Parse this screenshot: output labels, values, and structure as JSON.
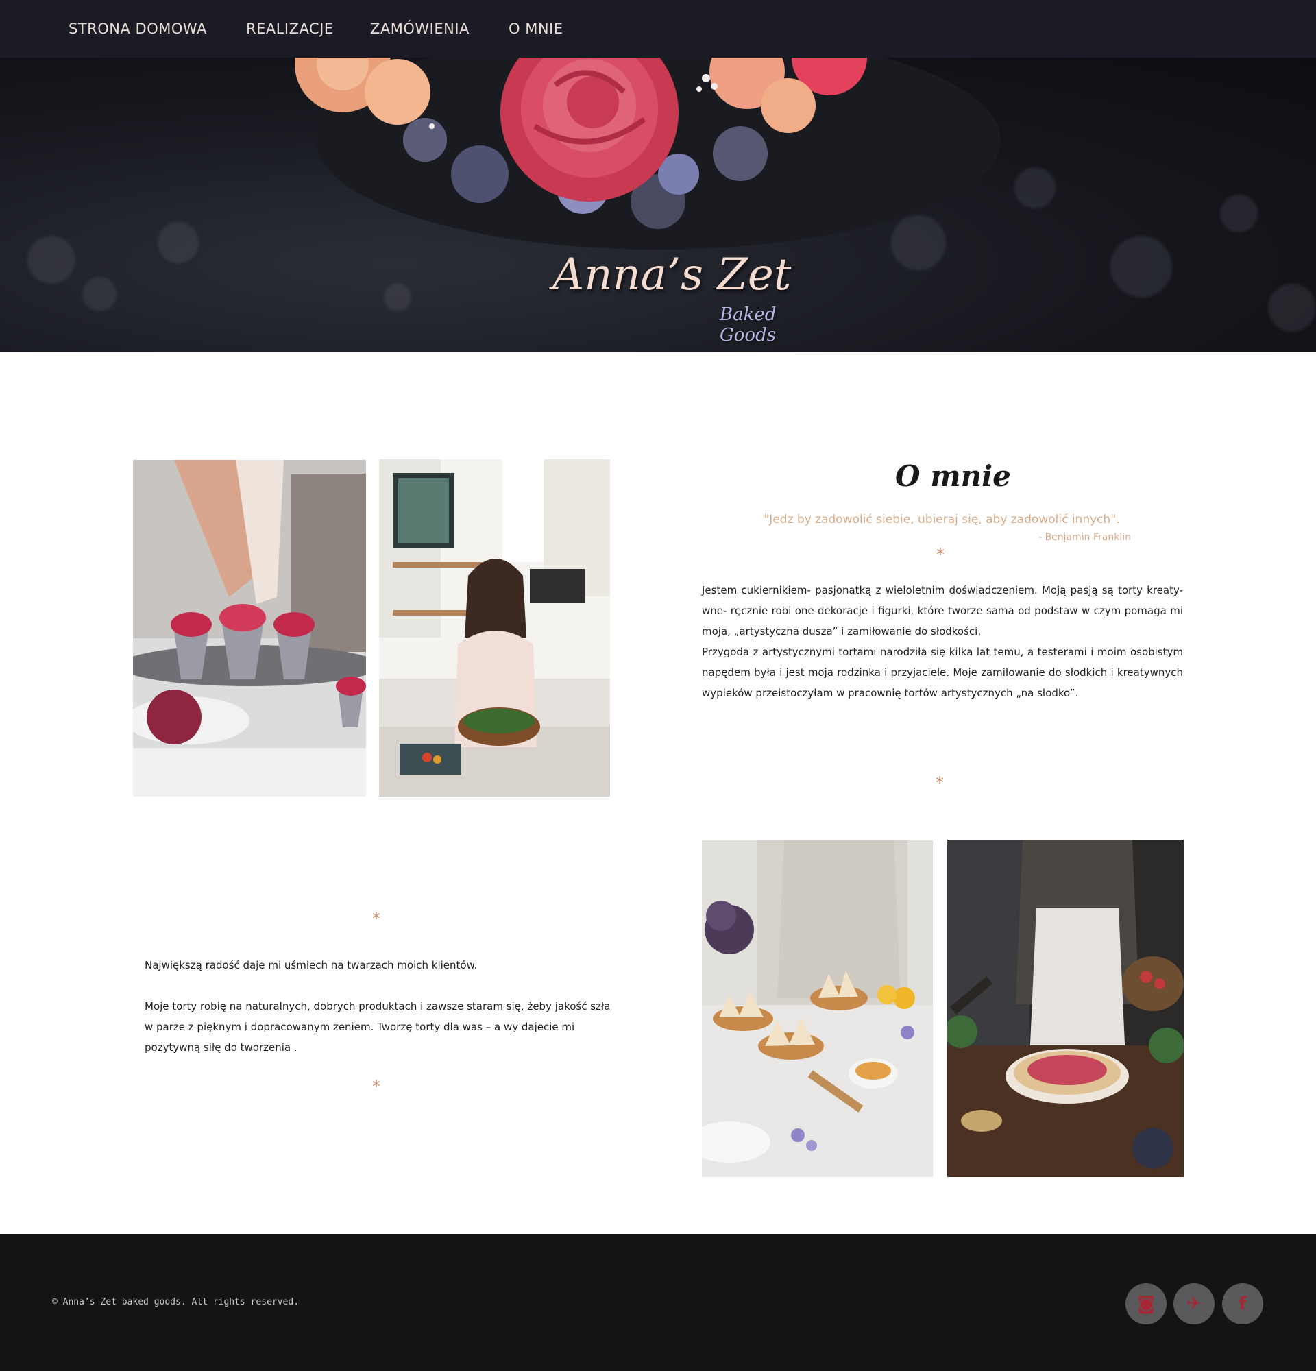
{
  "nav": {
    "items": [
      "STRONA DOMOWA",
      "REALIZACJE",
      "ZAMÓWIENIA",
      "O MNIE"
    ]
  },
  "hero": {
    "logo_main": "Anna’s Zet",
    "logo_sub": "Baked Goods"
  },
  "about": {
    "heading": "O mnie",
    "quote": "\"Jedz by zadowolić siebie, ubieraj się, aby zadowolić innych\".",
    "quote_author": "- Benjamin Franklin",
    "separator": "*",
    "paragraph1": "Jestem cukiernikiem- pasjonatką z wieloletnim doświadczeniem. Moją pasją są torty kreaty-wne- ręcznie robi one dekoracje i figurki, które tworze sama od podstaw w czym pomaga mi moja, „artystyczna dusza” i zamiłowanie do słodkości.",
    "paragraph2": "Przygoda z artystycznymi tortami narodziła się kilka lat temu, a testerami i moim osobistym napędem była i jest moja rodzinka i przyjaciele. Moje zamiłowanie do słodkich i kreatywnych wypieków przeistoczyłam w pracownię tortów artystycznych „na słodko”."
  },
  "left": {
    "paragraph1": "Największą radość daje mi uśmiech na twarzach moich klientów.",
    "paragraph2": "Moje torty  robię na naturalnych, dobrych produktach i zawsze staram się, żeby jakość szła w parze z pięknym i dopracowanym  zeniem. Tworzę torty dla was – a wy dajecie mi pozytywną siłę do tworzenia ."
  },
  "footer": {
    "copyright": "© Anna’s Zet baked goods. All rights reserved.",
    "social": [
      {
        "icon": "instagram-icon",
        "glyph": "◙"
      },
      {
        "icon": "twitter-icon",
        "glyph": "✈"
      },
      {
        "icon": "facebook-icon",
        "glyph": "f"
      }
    ]
  },
  "colors": {
    "nav_bg": "#1b1b25",
    "accent": "#d8ab8a",
    "footer_bg": "#141415",
    "social_icon": "#a82735"
  }
}
